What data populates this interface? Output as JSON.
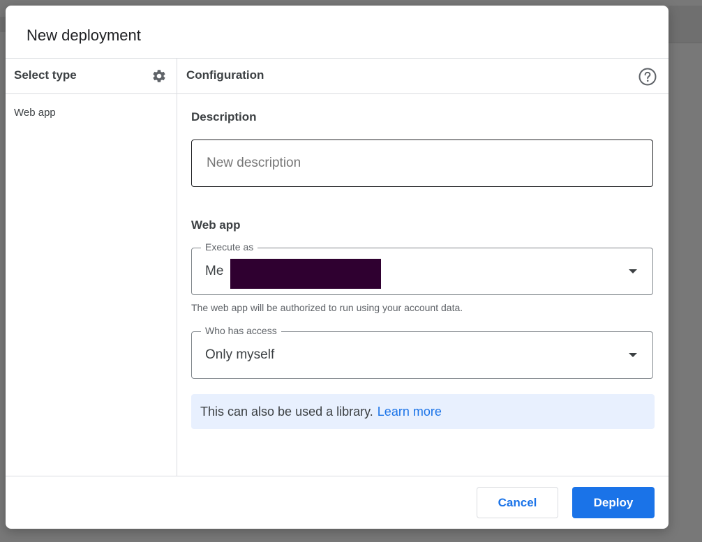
{
  "dialog": {
    "title": "New deployment"
  },
  "left_panel": {
    "header": "Select type",
    "header_icon": "gear-icon",
    "items": [
      {
        "label": "Web app"
      }
    ]
  },
  "right_panel": {
    "header": "Configuration",
    "header_icon": "help-icon",
    "description": {
      "label": "Description",
      "value": "",
      "placeholder": "New description"
    },
    "web_app": {
      "label": "Web app",
      "execute_as": {
        "label": "Execute as",
        "value": "Me"
      },
      "execute_hint": "The web app will be authorized to run using your account data.",
      "who_has_access": {
        "label": "Who has access",
        "value": "Only myself"
      }
    },
    "info": {
      "text": "This can also be used a library.",
      "link": "Learn more"
    }
  },
  "footer": {
    "cancel_label": "Cancel",
    "deploy_label": "Deploy"
  },
  "colors": {
    "accent": "#1a73e8",
    "info_bg": "#e8f0fe",
    "redaction": "#2f0030"
  }
}
